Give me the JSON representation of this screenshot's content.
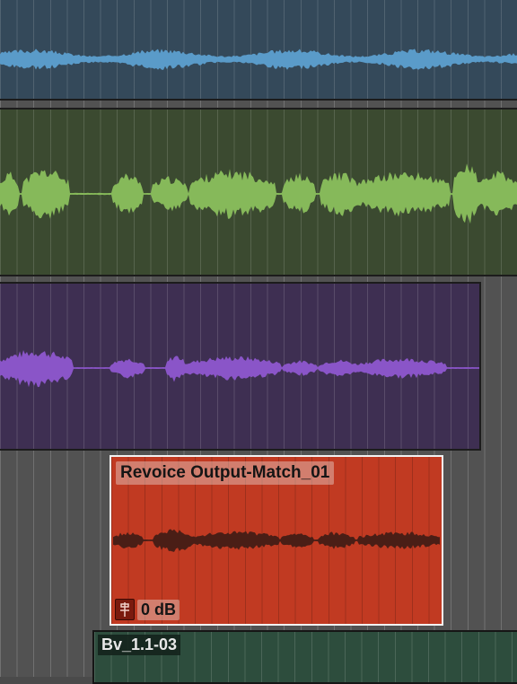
{
  "tracks": [
    {
      "name": "blue-track",
      "clip_color": "#34495a",
      "wave_color": "#5a9bc9"
    },
    {
      "name": "green-track",
      "clip_color": "#3b4a30",
      "wave_color": "#86b95a"
    },
    {
      "name": "purple-track",
      "clip_color": "#3e2f52",
      "wave_color": "#8a55c8"
    },
    {
      "name": "red-track",
      "clip_color": "#c13a22",
      "wave_color": "#4a1e16",
      "clip_name": "Revoice Output-Match_01",
      "gain": "0 dB"
    },
    {
      "name": "dark-green-track",
      "clip_color": "#2d4d3d",
      "clip_name": "Bv_1.1-03"
    }
  ],
  "colors": {
    "background": "#4a4a4a",
    "selected_clip_border": "#f2f2f2"
  },
  "icons": {
    "gain_icon": "clip-gain-icon"
  }
}
